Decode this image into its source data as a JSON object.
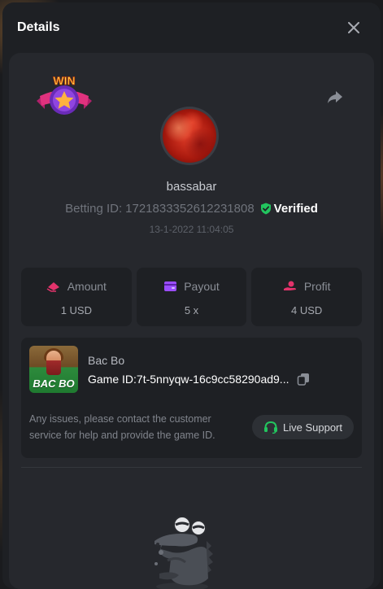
{
  "header": {
    "title": "Details"
  },
  "user": {
    "username": "bassabar",
    "betting_label": "Betting ID:",
    "betting_id": "1721833352612231808",
    "verified_label": "Verified",
    "timestamp": "13-1-2022 11:04:05"
  },
  "badge": {
    "text": "WIN"
  },
  "stats": [
    {
      "label": "Amount",
      "value": "1 USD",
      "icon": "amount-icon",
      "color": "#e2336b"
    },
    {
      "label": "Payout",
      "value": "5 x",
      "icon": "payout-icon",
      "color": "#9b4dff"
    },
    {
      "label": "Profit",
      "value": "4 USD",
      "icon": "profit-icon",
      "color": "#e2336b"
    }
  ],
  "game": {
    "name": "Bac Bo",
    "thumb_text": "BAC BO",
    "id_label": "Game ID:",
    "id_value": "7t-5nnyqw-16c9cc58290ad9..."
  },
  "support": {
    "message": "Any issues, please contact the customer service for help and provide the game ID.",
    "button_label": "Live Support"
  },
  "colors": {
    "verified": "#22c55e",
    "support_icon": "#22c55e",
    "panel": "#26282d",
    "card": "#1e2024"
  }
}
